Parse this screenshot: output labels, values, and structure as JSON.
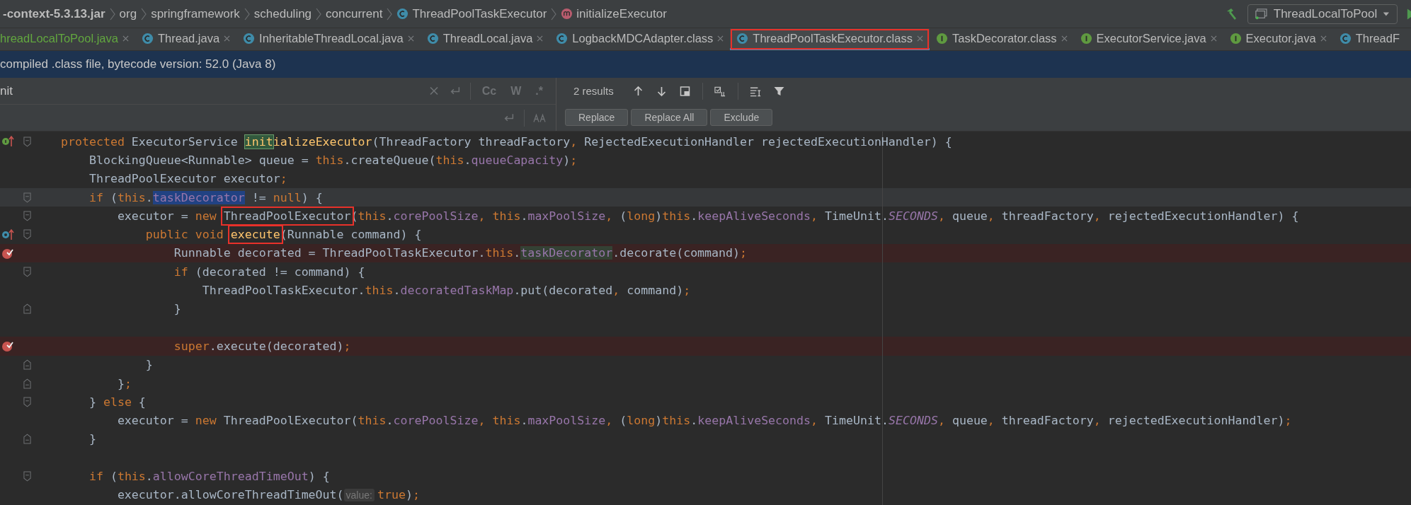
{
  "breadcrumb": {
    "items": [
      {
        "label": "-context-5.3.13.jar",
        "kind": "jar"
      },
      {
        "label": "org",
        "kind": "package"
      },
      {
        "label": "springframework",
        "kind": "package"
      },
      {
        "label": "scheduling",
        "kind": "package"
      },
      {
        "label": "concurrent",
        "kind": "package"
      },
      {
        "label": "ThreadPoolTaskExecutor",
        "kind": "class"
      },
      {
        "label": "initializeExecutor",
        "kind": "method"
      }
    ],
    "run_config": "ThreadLocalToPool"
  },
  "tabs": [
    {
      "label": "hreadLocalToPool.java",
      "kind": "none",
      "added": true,
      "selected": false,
      "boxed": false,
      "closable": true
    },
    {
      "label": "Thread.java",
      "kind": "class",
      "added": false,
      "selected": false,
      "boxed": false,
      "closable": true
    },
    {
      "label": "InheritableThreadLocal.java",
      "kind": "class",
      "added": false,
      "selected": false,
      "boxed": false,
      "closable": true
    },
    {
      "label": "ThreadLocal.java",
      "kind": "class",
      "added": false,
      "selected": false,
      "boxed": false,
      "closable": true
    },
    {
      "label": "LogbackMDCAdapter.class",
      "kind": "class",
      "added": false,
      "selected": false,
      "boxed": false,
      "closable": true
    },
    {
      "label": "ThreadPoolTaskExecutor.class",
      "kind": "class",
      "added": false,
      "selected": true,
      "boxed": true,
      "closable": true
    },
    {
      "label": "TaskDecorator.class",
      "kind": "interface",
      "added": false,
      "selected": false,
      "boxed": false,
      "closable": true
    },
    {
      "label": "ExecutorService.java",
      "kind": "interface",
      "added": false,
      "selected": false,
      "boxed": false,
      "closable": true
    },
    {
      "label": "Executor.java",
      "kind": "interface",
      "added": false,
      "selected": false,
      "boxed": false,
      "closable": true
    },
    {
      "label": "ThreadF",
      "kind": "class",
      "added": false,
      "selected": false,
      "boxed": false,
      "closable": false
    }
  ],
  "info_bar": "compiled .class file, bytecode version: 52.0 (Java 8)",
  "find": {
    "value": "nit",
    "options": [
      {
        "label": "Cc",
        "selected": false
      },
      {
        "label": "W",
        "selected": false
      },
      {
        "label": ".*",
        "selected": false
      }
    ],
    "results": "2 results",
    "buttons": [
      "Replace",
      "Replace All",
      "Exclude"
    ]
  },
  "code": [
    {
      "kind": "implements",
      "fold_start": true,
      "fold_end": false,
      "breakpoint": false,
      "current": false,
      "tokens": [
        {
          "t": "    protected",
          "kind": "kw"
        },
        {
          "t": " ExecutorService ",
          "kind": "plain"
        },
        {
          "t": "init",
          "kind": "method",
          "search_match": true
        },
        {
          "t": "ializeExecutor",
          "kind": "method"
        },
        {
          "t": "(ThreadFactory threadFactory",
          "kind": "plain"
        },
        {
          "t": ", ",
          "kind": "kw"
        },
        {
          "t": "RejectedExecutionHandler rejectedExecutionHandler) {",
          "kind": "plain"
        }
      ]
    },
    {
      "fold_start": false,
      "fold_end": false,
      "breakpoint": false,
      "current": false,
      "tokens": [
        {
          "t": "        BlockingQueue<Runnable> queue = ",
          "kind": "plain"
        },
        {
          "t": "this",
          "kind": "kw"
        },
        {
          "t": ".createQueue(",
          "kind": "plain"
        },
        {
          "t": "this",
          "kind": "kw"
        },
        {
          "t": ".",
          "kind": "plain"
        },
        {
          "t": "queueCapacity",
          "kind": "field"
        },
        {
          "t": ")",
          "kind": "plain"
        },
        {
          "t": ";",
          "kind": "kw"
        }
      ]
    },
    {
      "fold_start": false,
      "fold_end": false,
      "breakpoint": false,
      "current": false,
      "tokens": [
        {
          "t": "        ThreadPoolExecutor executor",
          "kind": "plain"
        },
        {
          "t": ";",
          "kind": "kw"
        }
      ]
    },
    {
      "fold_start": true,
      "fold_end": false,
      "breakpoint": false,
      "current": true,
      "tokens": [
        {
          "t": "        if",
          "kind": "kw"
        },
        {
          "t": " (",
          "kind": "plain"
        },
        {
          "t": "this",
          "kind": "kw"
        },
        {
          "t": ".",
          "kind": "plain"
        },
        {
          "t": "taskDecorator",
          "kind": "field",
          "selected": true
        },
        {
          "t": " != ",
          "kind": "plain"
        },
        {
          "t": "null",
          "kind": "kw"
        },
        {
          "t": ") {",
          "kind": "plain"
        }
      ]
    },
    {
      "fold_start": true,
      "fold_end": false,
      "breakpoint": false,
      "current": false,
      "tokens": [
        {
          "t": "            executor = ",
          "kind": "plain"
        },
        {
          "t": "new ",
          "kind": "kw"
        },
        {
          "t": "ThreadPoolExecutor",
          "kind": "plain",
          "boxed": true
        },
        {
          "t": "(",
          "kind": "plain"
        },
        {
          "t": "this",
          "kind": "kw"
        },
        {
          "t": ".",
          "kind": "plain"
        },
        {
          "t": "corePoolSize",
          "kind": "field"
        },
        {
          "t": ", ",
          "kind": "kw"
        },
        {
          "t": "this",
          "kind": "kw"
        },
        {
          "t": ".",
          "kind": "plain"
        },
        {
          "t": "maxPoolSize",
          "kind": "field"
        },
        {
          "t": ", ",
          "kind": "kw"
        },
        {
          "t": "(",
          "kind": "plain"
        },
        {
          "t": "long",
          "kind": "kw"
        },
        {
          "t": ")",
          "kind": "plain"
        },
        {
          "t": "this",
          "kind": "kw"
        },
        {
          "t": ".",
          "kind": "plain"
        },
        {
          "t": "keepAliveSeconds",
          "kind": "field"
        },
        {
          "t": ", ",
          "kind": "kw"
        },
        {
          "t": "TimeUnit.",
          "kind": "plain"
        },
        {
          "t": "SECONDS",
          "kind": "static"
        },
        {
          "t": ", ",
          "kind": "kw"
        },
        {
          "t": "queue",
          "kind": "plain"
        },
        {
          "t": ", ",
          "kind": "kw"
        },
        {
          "t": "threadFactory",
          "kind": "plain"
        },
        {
          "t": ", ",
          "kind": "kw"
        },
        {
          "t": "rejectedExecutionHandler) {",
          "kind": "plain"
        }
      ]
    },
    {
      "kind": "overrides",
      "fold_start": true,
      "fold_end": false,
      "breakpoint": false,
      "current": false,
      "tokens": [
        {
          "t": "                public void ",
          "kind": "kw"
        },
        {
          "t": "execute",
          "kind": "method",
          "boxed": true
        },
        {
          "t": "(Runnable command) {",
          "kind": "plain"
        }
      ]
    },
    {
      "fold_start": false,
      "fold_end": false,
      "breakpoint": true,
      "current": false,
      "tokens": [
        {
          "t": "                    Runnable decorated = ThreadPoolTaskExecutor.",
          "kind": "plain"
        },
        {
          "t": "this",
          "kind": "kw"
        },
        {
          "t": ".",
          "kind": "plain"
        },
        {
          "t": "taskDecorator",
          "kind": "field",
          "usage_highlight": true
        },
        {
          "t": ".decorate(command)",
          "kind": "plain"
        },
        {
          "t": ";",
          "kind": "kw"
        }
      ]
    },
    {
      "fold_start": true,
      "fold_end": false,
      "breakpoint": false,
      "current": false,
      "tokens": [
        {
          "t": "                    if",
          "kind": "kw"
        },
        {
          "t": " (decorated != command) {",
          "kind": "plain"
        }
      ]
    },
    {
      "fold_start": false,
      "fold_end": false,
      "breakpoint": false,
      "current": false,
      "tokens": [
        {
          "t": "                        ThreadPoolTaskExecutor.",
          "kind": "plain"
        },
        {
          "t": "this",
          "kind": "kw"
        },
        {
          "t": ".",
          "kind": "plain"
        },
        {
          "t": "decoratedTaskMap",
          "kind": "field"
        },
        {
          "t": ".put(decorated",
          "kind": "plain"
        },
        {
          "t": ", ",
          "kind": "kw"
        },
        {
          "t": "command)",
          "kind": "plain"
        },
        {
          "t": ";",
          "kind": "kw"
        }
      ]
    },
    {
      "fold_start": false,
      "fold_end": true,
      "breakpoint": false,
      "current": false,
      "tokens": [
        {
          "t": "                    }",
          "kind": "plain"
        }
      ]
    },
    {
      "fold_start": false,
      "fold_end": false,
      "breakpoint": false,
      "current": false
    },
    {
      "fold_start": false,
      "fold_end": false,
      "breakpoint": true,
      "current": false,
      "tokens": [
        {
          "t": "                    super",
          "kind": "kw"
        },
        {
          "t": ".execute(decorated)",
          "kind": "plain"
        },
        {
          "t": ";",
          "kind": "kw"
        }
      ]
    },
    {
      "fold_start": false,
      "fold_end": true,
      "breakpoint": false,
      "current": false,
      "tokens": [
        {
          "t": "                }",
          "kind": "plain"
        }
      ]
    },
    {
      "fold_start": false,
      "fold_end": true,
      "breakpoint": false,
      "current": false,
      "tokens": [
        {
          "t": "            }",
          "kind": "plain"
        },
        {
          "t": ";",
          "kind": "kw"
        }
      ]
    },
    {
      "fold_start": true,
      "fold_end": false,
      "breakpoint": false,
      "current": false,
      "tokens": [
        {
          "t": "        } ",
          "kind": "plain"
        },
        {
          "t": "else",
          "kind": "kw"
        },
        {
          "t": " {",
          "kind": "plain"
        }
      ]
    },
    {
      "fold_start": false,
      "fold_end": false,
      "breakpoint": false,
      "current": false,
      "tokens": [
        {
          "t": "            executor = ",
          "kind": "plain"
        },
        {
          "t": "new",
          "kind": "kw"
        },
        {
          "t": " ThreadPoolExecutor(",
          "kind": "plain"
        },
        {
          "t": "this",
          "kind": "kw"
        },
        {
          "t": ".",
          "kind": "plain"
        },
        {
          "t": "corePoolSize",
          "kind": "field"
        },
        {
          "t": ", ",
          "kind": "kw"
        },
        {
          "t": "this",
          "kind": "kw"
        },
        {
          "t": ".",
          "kind": "plain"
        },
        {
          "t": "maxPoolSize",
          "kind": "field"
        },
        {
          "t": ", ",
          "kind": "kw"
        },
        {
          "t": "(",
          "kind": "plain"
        },
        {
          "t": "long",
          "kind": "kw"
        },
        {
          "t": ")",
          "kind": "plain"
        },
        {
          "t": "this",
          "kind": "kw"
        },
        {
          "t": ".",
          "kind": "plain"
        },
        {
          "t": "keepAliveSeconds",
          "kind": "field"
        },
        {
          "t": ", ",
          "kind": "kw"
        },
        {
          "t": "TimeUnit.",
          "kind": "plain"
        },
        {
          "t": "SECONDS",
          "kind": "static"
        },
        {
          "t": ", ",
          "kind": "kw"
        },
        {
          "t": "queue",
          "kind": "plain"
        },
        {
          "t": ", ",
          "kind": "kw"
        },
        {
          "t": "threadFactory",
          "kind": "plain"
        },
        {
          "t": ", ",
          "kind": "kw"
        },
        {
          "t": "rejectedExecutionHandler)",
          "kind": "plain"
        },
        {
          "t": ";",
          "kind": "kw"
        }
      ]
    },
    {
      "fold_start": false,
      "fold_end": true,
      "breakpoint": false,
      "current": false,
      "tokens": [
        {
          "t": "        }",
          "kind": "plain"
        }
      ]
    },
    {
      "fold_start": false,
      "fold_end": false,
      "breakpoint": false,
      "current": false
    },
    {
      "fold_start": true,
      "fold_end": false,
      "breakpoint": false,
      "current": false,
      "tokens": [
        {
          "t": "        if",
          "kind": "kw"
        },
        {
          "t": " (",
          "kind": "plain"
        },
        {
          "t": "this",
          "kind": "kw"
        },
        {
          "t": ".",
          "kind": "plain"
        },
        {
          "t": "allowCoreThreadTimeOut",
          "kind": "field"
        },
        {
          "t": ") {",
          "kind": "plain"
        }
      ]
    },
    {
      "fold_start": false,
      "fold_end": false,
      "breakpoint": false,
      "current": false,
      "tokens": [
        {
          "t": "            executor.allowCoreThreadTimeOut(",
          "kind": "plain"
        },
        {
          "t": "value:",
          "kind": "hint"
        },
        {
          "t": "true",
          "kind": "kw"
        },
        {
          "t": ")",
          "kind": "plain"
        },
        {
          "t": ";",
          "kind": "kw"
        }
      ]
    }
  ]
}
